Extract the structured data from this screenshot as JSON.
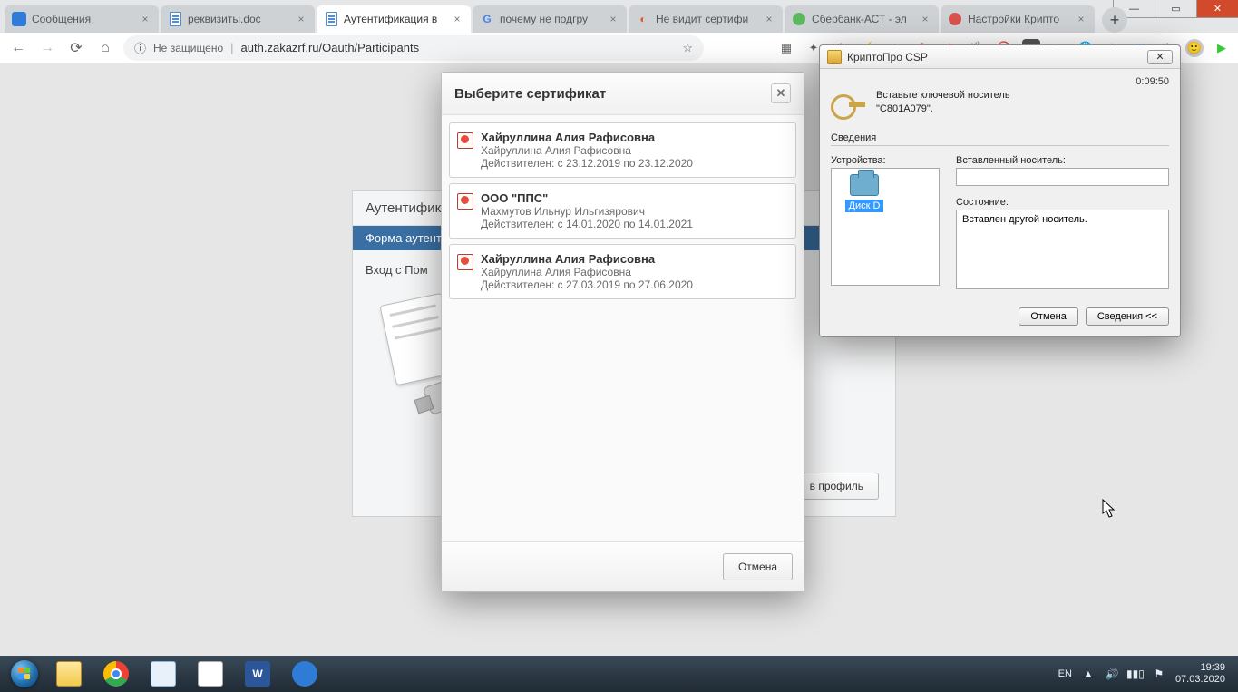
{
  "browser": {
    "tabs": [
      {
        "label": "Сообщения",
        "favicon": "blue"
      },
      {
        "label": "реквизиты.doc",
        "favicon": "doc"
      },
      {
        "label": "Аутентификация в",
        "favicon": "doc",
        "active": true
      },
      {
        "label": "почему не подгру",
        "favicon": "g"
      },
      {
        "label": "Не видит сертифи",
        "favicon": "o"
      },
      {
        "label": "Сбербанк-АСТ - эл",
        "favicon": "green"
      },
      {
        "label": "Настройки Крипто",
        "favicon": "red"
      }
    ],
    "newtab_plus": "+",
    "nav": {
      "back": "←",
      "forward": "→",
      "reload": "⟳",
      "home": "⌂"
    },
    "security_label": "Не защищено",
    "url": "auth.zakazrf.ru/Oauth/Participants",
    "bookmark": "☆",
    "extensions": [
      "▦",
      "✦",
      "⚙",
      "⚡",
      "◉",
      "✚",
      "❖",
      "🐞",
      "🚫",
      "M",
      "⊕",
      "🌐",
      "✈",
      "⋮"
    ],
    "avatar": "◯",
    "ext_badge": "▶"
  },
  "auth_panel": {
    "header": "Аутентифик",
    "tab": "Форма аутентификации",
    "body": "Вход с Пом",
    "footer_btn": "в профиль"
  },
  "cert": {
    "title": "Выберите сертификат",
    "close": "✕",
    "items": [
      {
        "name": "Хайруллина Алия Рафисовна",
        "sub": "Хайруллина Алия Рафисовна",
        "valid": "Действителен: с 23.12.2019 по 23.12.2020"
      },
      {
        "name": "ООО \"ППС\"",
        "sub": "Махмутов Ильнур Ильгизярович",
        "valid": "Действителен: с 14.01.2020 по 14.01.2021"
      },
      {
        "name": "Хайруллина Алия Рафисовна",
        "sub": "Хайруллина Алия Рафисовна",
        "valid": "Действителен: с 27.03.2019 по 27.06.2020"
      }
    ],
    "cancel": "Отмена"
  },
  "csp": {
    "title": "КриптоПро CSP",
    "close": "✕",
    "timer": "0:09:50",
    "msg_line1": "Вставьте ключевой носитель",
    "msg_line2": "\"C801A079\".",
    "section": "Сведения",
    "devices_label": "Устройства:",
    "media_label": "Вставленный носитель:",
    "state_label": "Состояние:",
    "device_name": "Диск D",
    "state_text": "Вставлен другой носитель.",
    "btn_cancel": "Отмена",
    "btn_details": "Сведения <<"
  },
  "taskbar": {
    "lang": "EN",
    "up": "▲",
    "time": "19:39",
    "date": "07.03.2020"
  },
  "win": {
    "min": "—",
    "max": "▭",
    "close": "✕"
  }
}
